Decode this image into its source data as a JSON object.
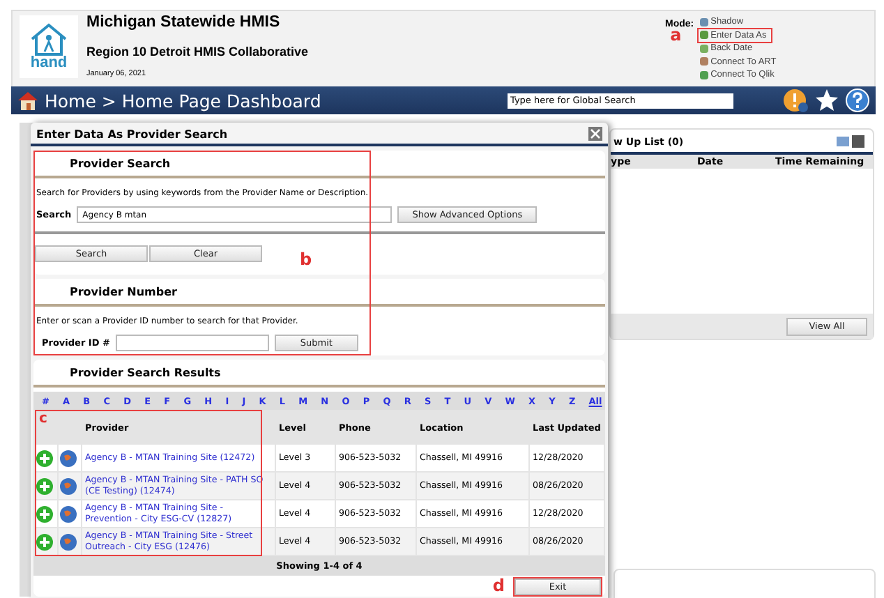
{
  "header": {
    "logo_text": "hand",
    "title": "Michigan Statewide HMIS",
    "subtitle": "Region 10 Detroit HMIS Collaborative",
    "date": "January 06, 2021",
    "mode_label": "Mode:",
    "modes": [
      {
        "label": "Shadow"
      },
      {
        "label": "Enter Data As",
        "callout": "a"
      },
      {
        "label": "Back Date"
      },
      {
        "label": "Connect To ART"
      },
      {
        "label": "Connect To Qlik"
      }
    ]
  },
  "nav": {
    "breadcrumb": "Home > Home Page Dashboard",
    "search": {
      "placeholder": "Type here for Global Search"
    }
  },
  "background_panel": {
    "title": "w Up List (0)",
    "columns": [
      "ype",
      "Date",
      "Time Remaining"
    ],
    "button": "View All"
  },
  "dialog": {
    "title": "Enter Data As Provider Search",
    "search_callout": "b",
    "provider_search": {
      "heading": "Provider Search",
      "hint": "Search for Providers by using keywords from the Provider Name or Description.",
      "field_label": "Search",
      "value": "Agency B mtan",
      "advanced_button": "Show Advanced Options",
      "buttons": [
        "Search",
        "Clear"
      ]
    },
    "provider_number": {
      "heading": "Provider Number",
      "hint": "Enter or scan a Provider ID number to search for that Provider.",
      "field_label": "Provider ID #",
      "submit_button": "Submit"
    },
    "results": {
      "heading": "Provider Search Results",
      "provider_callout": "c",
      "letters": [
        "#",
        "A",
        "B",
        "C",
        "D",
        "E",
        "F",
        "G",
        "H",
        "I",
        "J",
        "K",
        "L",
        "M",
        "N",
        "O",
        "P",
        "Q",
        "R",
        "S",
        "T",
        "U",
        "V",
        "W",
        "X",
        "Y",
        "Z",
        "All"
      ],
      "columns": [
        "Provider",
        "Level",
        "Phone",
        "Location",
        "Last Updated"
      ],
      "rows": [
        {
          "provider": "Agency B - MTAN Training Site (12472)",
          "level": "Level 3",
          "phone": "906-523-5032",
          "location": "Chassell, MI 49916",
          "updated": "12/28/2020"
        },
        {
          "provider": "Agency B - MTAN Training Site - PATH SO (CE Testing) (12474)",
          "level": "Level 4",
          "phone": "906-523-5032",
          "location": "Chassell, MI 49916",
          "updated": "08/26/2020"
        },
        {
          "provider": "Agency B - MTAN Training Site - Prevention - City ESG-CV (12827)",
          "level": "Level 4",
          "phone": "906-523-5032",
          "location": "Chassell, MI 49916",
          "updated": "12/28/2020"
        },
        {
          "provider": "Agency B - MTAN Training Site - Street Outreach - City ESG (12476)",
          "level": "Level 4",
          "phone": "906-523-5032",
          "location": "Chassell, MI 49916",
          "updated": "08/26/2020"
        }
      ],
      "footer": "Showing 1-4 of 4"
    },
    "exit_button": {
      "label": "Exit",
      "callout": "d"
    }
  }
}
